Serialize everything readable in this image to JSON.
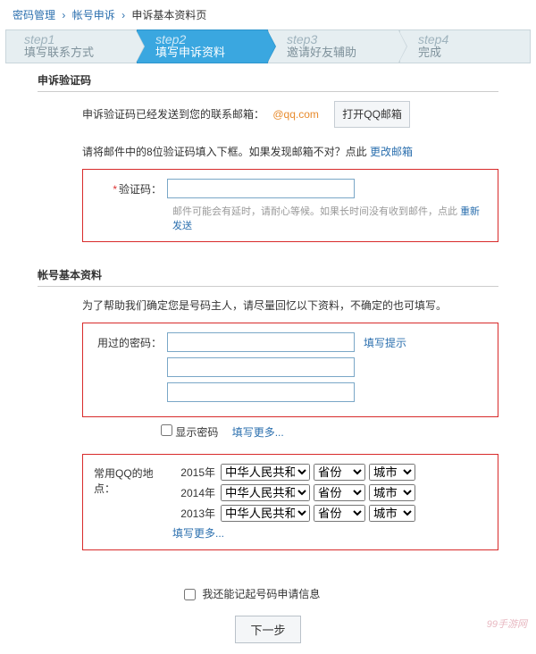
{
  "breadcrumb": {
    "item1": "密码管理",
    "item2": "帐号申诉",
    "item3": "申诉基本资料页"
  },
  "steps": [
    {
      "num": "step1",
      "label": "填写联系方式"
    },
    {
      "num": "step2",
      "label": "填写申诉资料"
    },
    {
      "num": "step3",
      "label": "邀请好友辅助"
    },
    {
      "num": "step4",
      "label": "完成"
    }
  ],
  "verify": {
    "title": "申诉验证码",
    "sent_text_pre": "申诉验证码已经发送到您的联系邮箱：",
    "email": "@qq.com",
    "open_mail_btn": "打开QQ邮箱",
    "hint_pre": "请将邮件中的8位验证码填入下框。如果发现邮箱不对？点此",
    "change_mail": "更改邮箱",
    "code_label": "验证码：",
    "helper_pre": "邮件可能会有延时，请耐心等候。如果长时间没有收到邮件，点此",
    "resend": "重新发送"
  },
  "basic": {
    "title": "帐号基本资料",
    "desc": "为了帮助我们确定您是号码主人，请尽量回忆以下资料，不确定的也可填写。",
    "pwd_label": "用过的密码：",
    "hint_link": "填写提示",
    "show_pwd": "显示密码",
    "more_link": "填写更多...",
    "loc_label": "常用QQ的地点：",
    "years": [
      "2015年",
      "2014年",
      "2013年"
    ],
    "country": "中华人民共和国",
    "province": "省份",
    "city": "城市",
    "more_loc": "填写更多..."
  },
  "remember_checkbox": "我还能记起号码申请信息",
  "next_btn": "下一步",
  "watermark": "99手游网"
}
